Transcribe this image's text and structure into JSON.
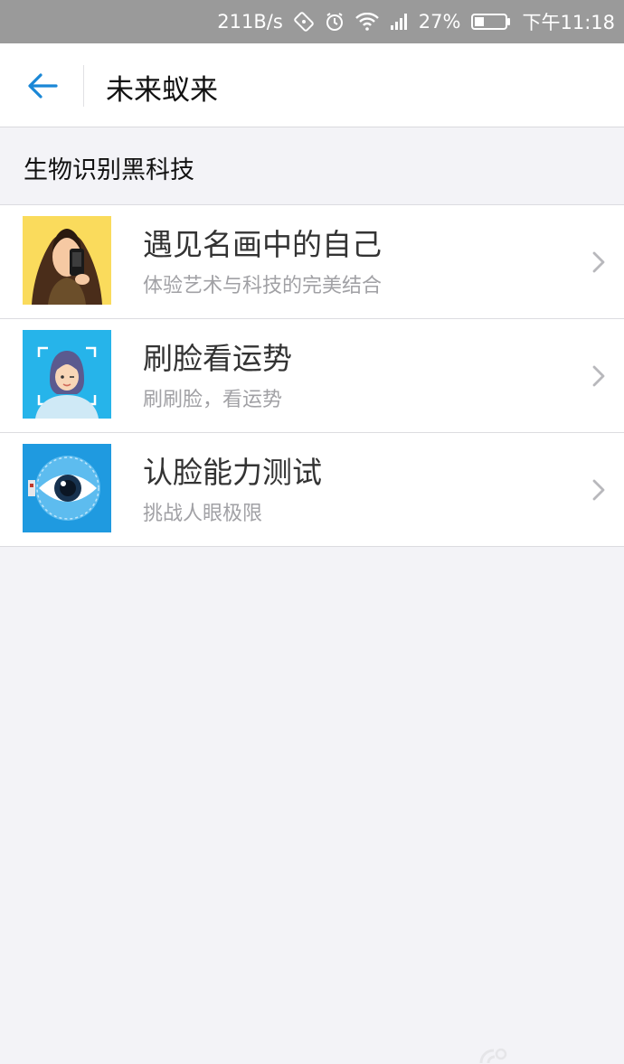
{
  "status_bar": {
    "speed": "211B/s",
    "battery": "27%",
    "time": "下午11:18"
  },
  "header": {
    "title": "未来蚁来"
  },
  "section": {
    "label": "生物识别黑科技"
  },
  "items": [
    {
      "title": "遇见名画中的自己",
      "subtitle": "体验艺术与科技的完美结合",
      "icon": "mona-lisa-phone-icon"
    },
    {
      "title": "刷脸看运势",
      "subtitle": "刷刷脸，看运势",
      "icon": "face-scan-girl-icon"
    },
    {
      "title": "认脸能力测试",
      "subtitle": "挑战人眼极限",
      "icon": "eye-scan-icon"
    }
  ],
  "colors": {
    "status_bar_bg": "#9a9a9a",
    "accent": "#1a87d6",
    "page_bg": "#f3f3f7"
  }
}
